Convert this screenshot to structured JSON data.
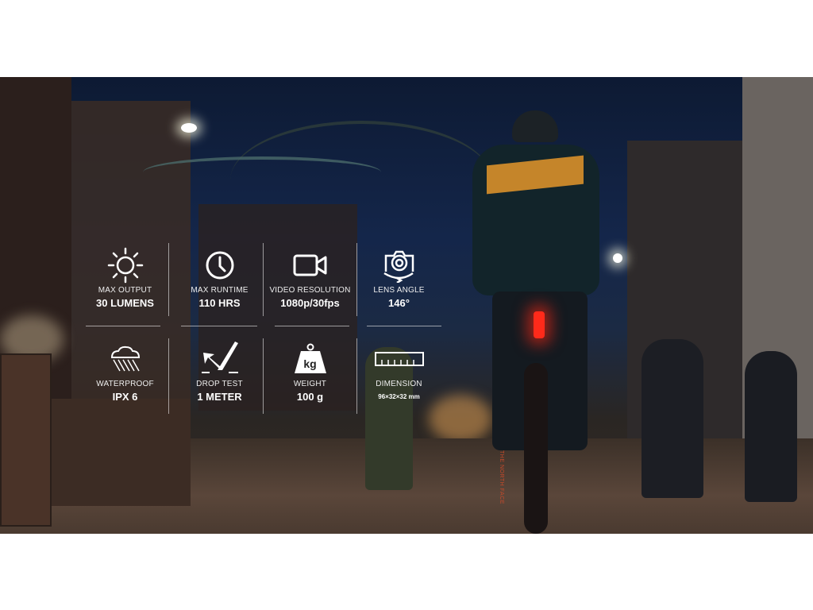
{
  "specs": [
    {
      "icon": "sun-icon",
      "label": "MAX OUTPUT",
      "value": "30 LUMENS"
    },
    {
      "icon": "clock-icon",
      "label": "MAX RUNTIME",
      "value": "110 HRS"
    },
    {
      "icon": "video-camera-icon",
      "label": "VIDEO RESOLUTION",
      "value": "1080p/30fps"
    },
    {
      "icon": "camera-rotate-icon",
      "label": "LENS ANGLE",
      "value": "146°"
    },
    {
      "icon": "rain-cloud-icon",
      "label": "WATERPROOF",
      "value": "IPX 6"
    },
    {
      "icon": "drop-arrow-icon",
      "label": "DROP TEST",
      "value": "1 METER"
    },
    {
      "icon": "weight-icon",
      "label": "WEIGHT",
      "value": "100 g",
      "icon_text": "kg"
    },
    {
      "icon": "ruler-icon",
      "label": "DIMENSION",
      "value": "96×32×32 mm"
    }
  ],
  "photo": {
    "jersey_text": "THE NORTH FACE"
  },
  "colors": {
    "tail_light": "#ff2a1a",
    "jersey_stripe": "#d9902a"
  }
}
